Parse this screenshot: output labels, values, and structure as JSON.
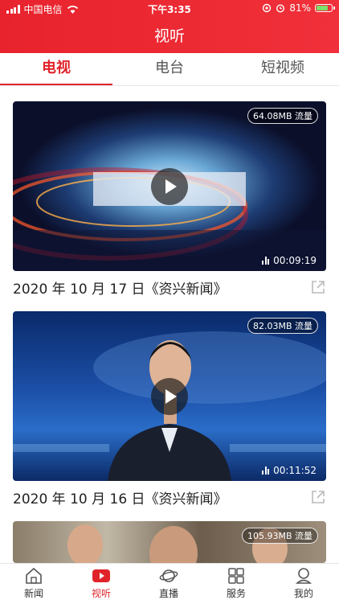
{
  "status_bar": {
    "carrier": "中国电信",
    "time": "下午3:35",
    "battery": "81%",
    "battery_level": 0.81
  },
  "header": {
    "title": "视听"
  },
  "tabs": [
    {
      "label": "电视",
      "active": true
    },
    {
      "label": "电台",
      "active": false
    },
    {
      "label": "短视频",
      "active": false
    }
  ],
  "videos": [
    {
      "size": "64.08MB 流量",
      "duration": "00:09:19",
      "title": "2020 年 10 月 17 日《资兴新闻》"
    },
    {
      "size": "82.03MB 流量",
      "duration": "00:11:52",
      "title": "2020 年 10 月 16 日《资兴新闻》"
    },
    {
      "size": "105.93MB 流量"
    }
  ],
  "tabbar": [
    {
      "label": "新闻",
      "icon": "home-icon"
    },
    {
      "label": "视听",
      "icon": "play-video-icon",
      "active": true
    },
    {
      "label": "直播",
      "icon": "planet-icon"
    },
    {
      "label": "服务",
      "icon": "grid-icon"
    },
    {
      "label": "我的",
      "icon": "user-icon"
    }
  ],
  "colors": {
    "accent": "#e0232b",
    "header": "#ee2b35"
  }
}
